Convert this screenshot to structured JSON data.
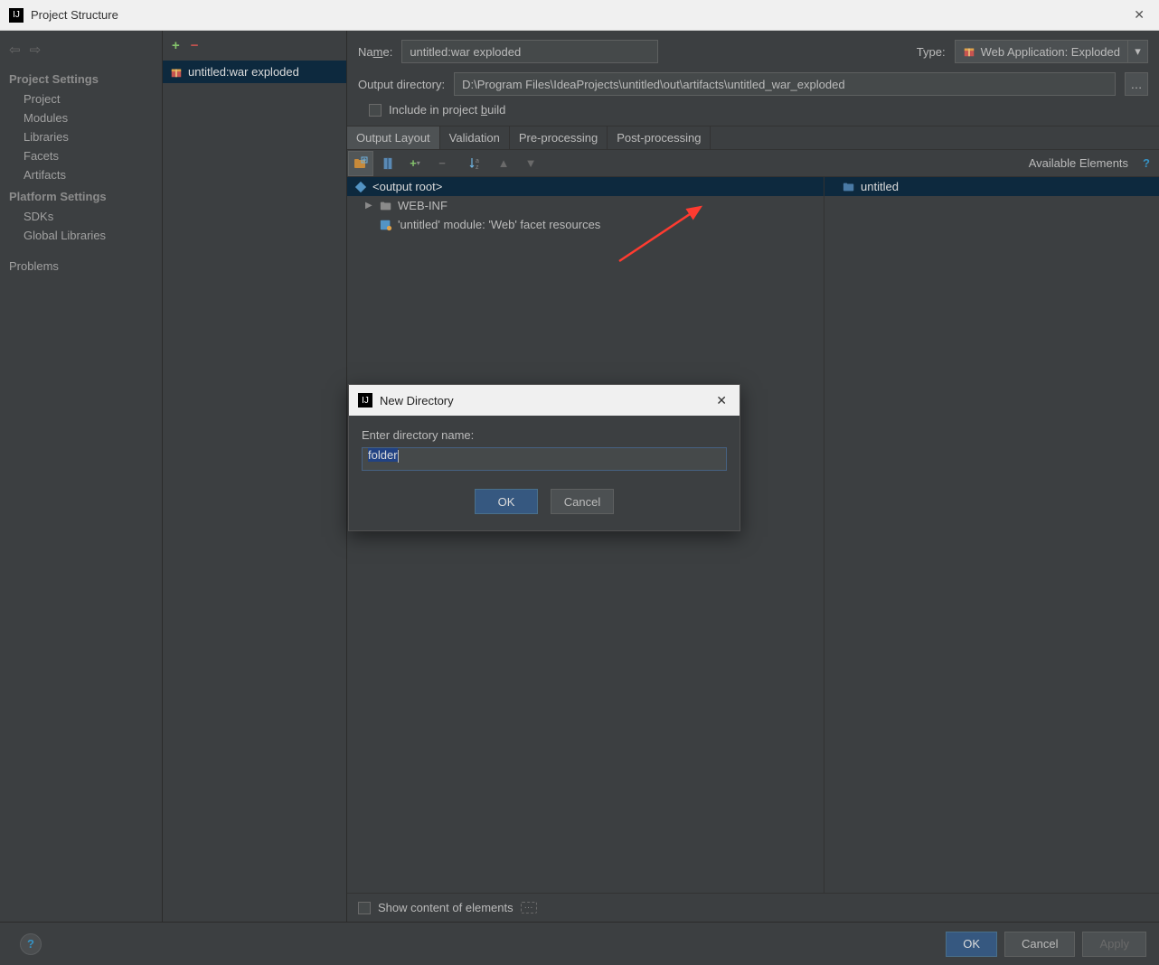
{
  "window": {
    "title": "Project Structure"
  },
  "sidebar": {
    "section1": "Project Settings",
    "items1": [
      "Project",
      "Modules",
      "Libraries",
      "Facets",
      "Artifacts"
    ],
    "section2": "Platform Settings",
    "items2": [
      "SDKs",
      "Global Libraries"
    ],
    "section3": "Problems"
  },
  "middle": {
    "artifact_name": "untitled:war exploded"
  },
  "form": {
    "name_label_before": "Na",
    "name_label_u": "m",
    "name_label_after": "e:",
    "name_value": "untitled:war exploded",
    "type_label": "Type:",
    "type_value": "Web Application: Exploded",
    "output_label": "Output directory:",
    "output_value": "D:\\Program Files\\IdeaProjects\\untitled\\out\\artifacts\\untitled_war_exploded",
    "include_before": "Include in project ",
    "include_u": "b",
    "include_after": "uild"
  },
  "tabs": [
    "Output Layout",
    "Validation",
    "Pre-processing",
    "Post-processing"
  ],
  "available_label": "Available Elements",
  "tree": {
    "root": "<output root>",
    "webinf": "WEB-INF",
    "facet": "'untitled' module: 'Web' facet resources",
    "untitled": "untitled"
  },
  "show_content": "Show content of elements",
  "footer": {
    "ok": "OK",
    "cancel": "Cancel",
    "apply": "Apply"
  },
  "modal": {
    "title": "New Directory",
    "label": "Enter directory name:",
    "value": "folder",
    "ok": "OK",
    "cancel": "Cancel"
  }
}
